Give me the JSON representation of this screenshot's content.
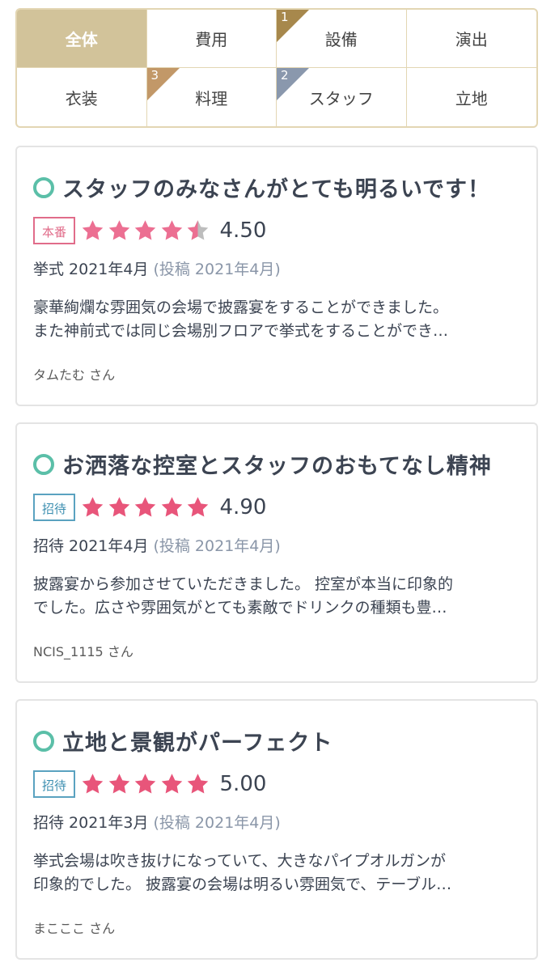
{
  "tabs": [
    {
      "label": "全体",
      "active": true
    },
    {
      "label": "費用"
    },
    {
      "label": "設備",
      "rank": "1",
      "rank_color": "#a7884c"
    },
    {
      "label": "演出"
    },
    {
      "label": "衣装"
    },
    {
      "label": "料理",
      "rank": "3",
      "rank_color": "#c29868"
    },
    {
      "label": "スタッフ",
      "rank": "2",
      "rank_color": "#8a98ad"
    },
    {
      "label": "立地"
    }
  ],
  "reviews": [
    {
      "title": "スタッフのみなさんがとても明るいです！",
      "badge": "本番",
      "rating": 4.5,
      "score": "4.50",
      "date": "挙式 2021年4月",
      "posted": "(投稿 2021年4月)",
      "body_line1": "豪華絢爛な雰囲気の会場で披露宴をすることができました。",
      "body_line2": "また神前式では同じ会場別フロアで挙式をすることができ…",
      "author": "タムたむ さん"
    },
    {
      "title": "お洒落な控室とスタッフのおもてなし精神",
      "badge": "招待",
      "rating": 4.9,
      "score": "4.90",
      "date": "招待 2021年4月",
      "posted": "(投稿 2021年4月)",
      "body_line1": "披露宴から参加させていただきました。 控室が本当に印象的",
      "body_line2": "でした。広さや雰囲気がとても素敵でドリンクの種類も豊…",
      "author": "NCIS_1115 さん"
    },
    {
      "title": "立地と景観がパーフェクト",
      "badge": "招待",
      "rating": 5.0,
      "score": "5.00",
      "date": "招待 2021年3月",
      "posted": "(投稿 2021年4月)",
      "body_line1": "挙式会場は吹き抜けになっていて、大きなパイプオルガンが",
      "body_line2": "印象的でした。 披露宴の会場は明るい雰囲気で、テーブル…",
      "author": "まこここ さん"
    }
  ],
  "colors": {
    "tab_border": "#e3d6b3",
    "tab_active": "#d2c39a",
    "star_pink": "#e8557a",
    "star_honban": "#ec6f92",
    "star_empty": "#bdbdbd",
    "ring": "#5bbfa8"
  }
}
